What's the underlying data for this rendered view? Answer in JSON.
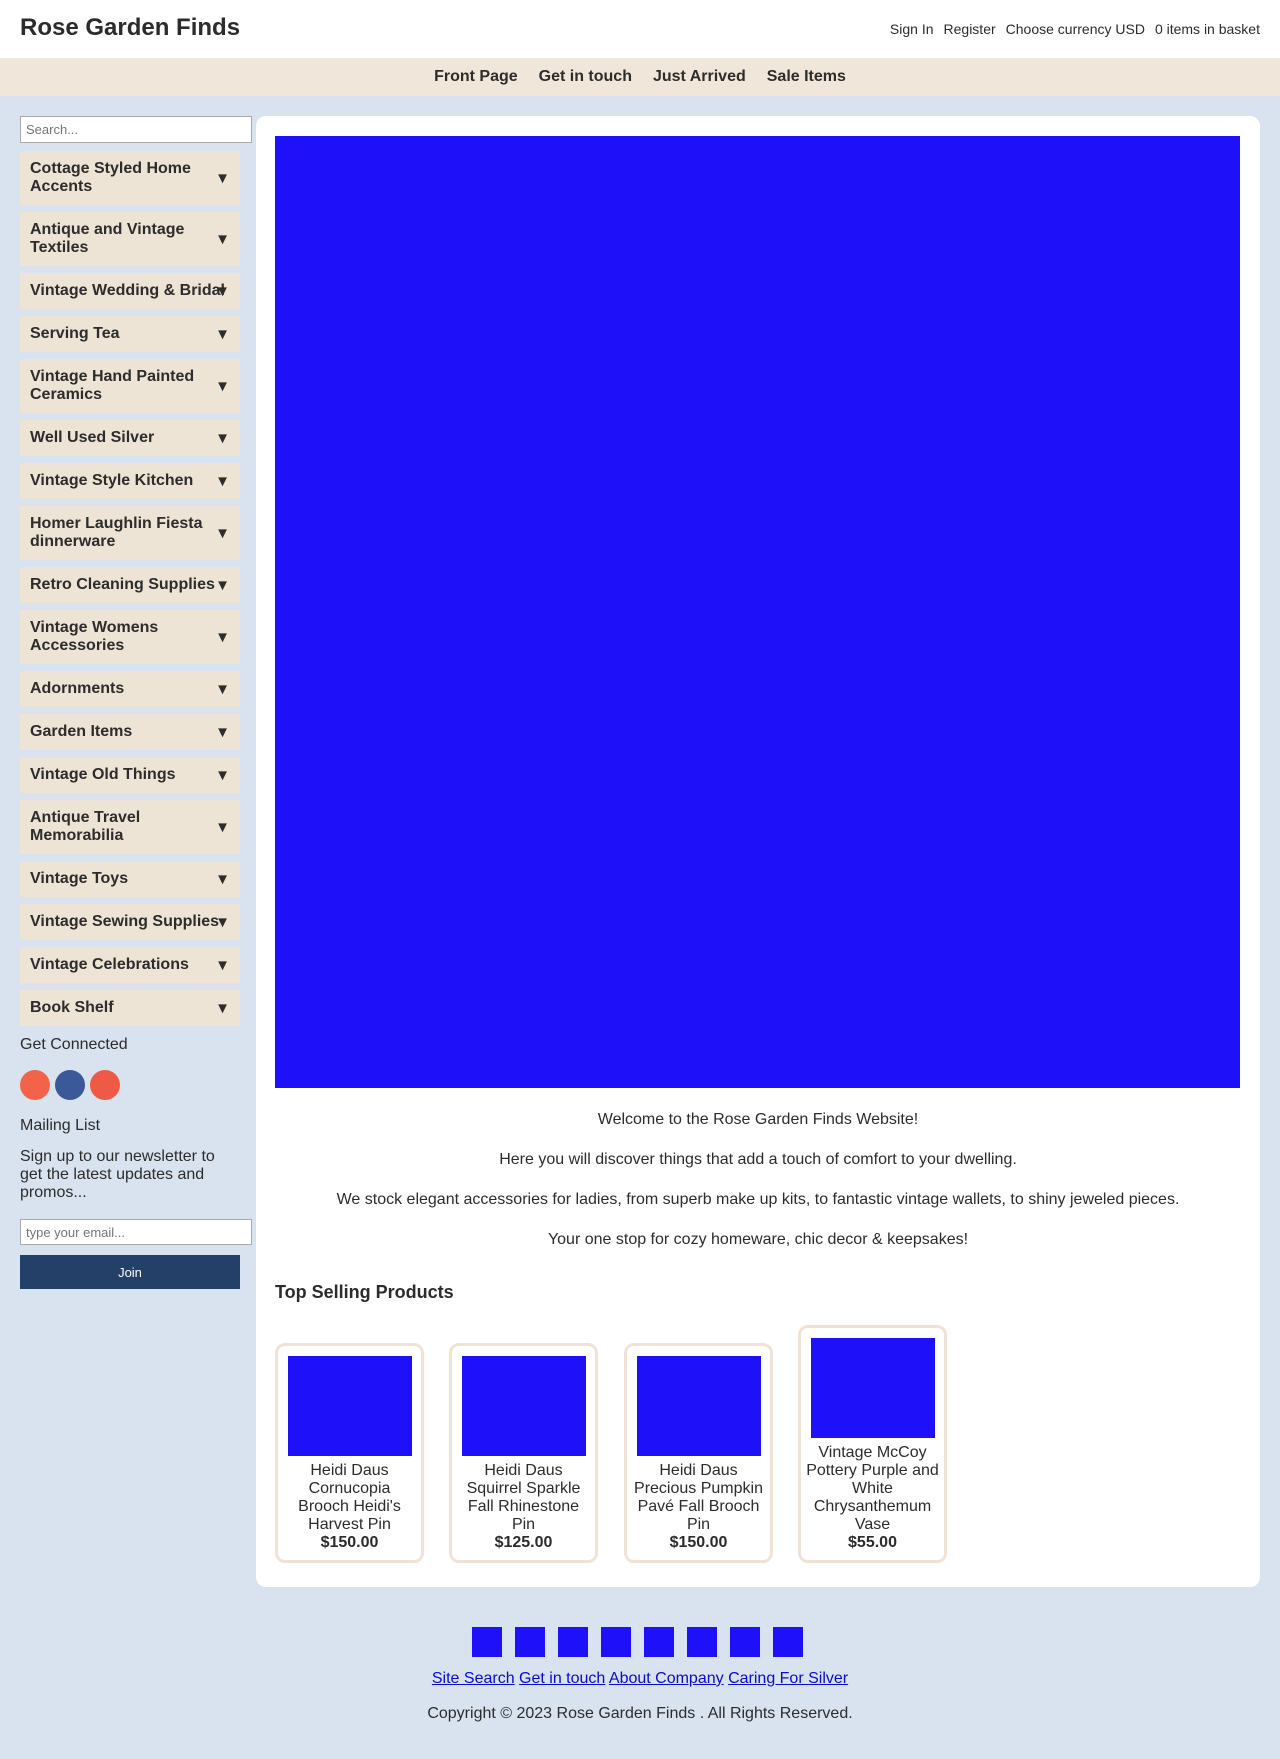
{
  "header": {
    "title": "Rose Garden Finds",
    "links": [
      "Sign In",
      "Register",
      "Choose currency USD",
      "0 items in basket"
    ]
  },
  "nav": [
    "Front Page",
    "Get in touch",
    "Just Arrived",
    "Sale Items"
  ],
  "sidebar": {
    "search_placeholder": "Search...",
    "categories": [
      "Cottage Styled Home Accents",
      "Antique and Vintage Textiles",
      "Vintage Wedding & Bridal",
      "Serving Tea",
      "Vintage Hand Painted Ceramics",
      "Well Used Silver",
      "Vintage Style Kitchen",
      "Homer Laughlin Fiesta dinnerware",
      "Retro Cleaning Supplies",
      "Vintage Womens Accessories",
      "Adornments",
      "Garden Items",
      "Vintage Old Things",
      "Antique Travel Memorabilia",
      "Vintage Toys",
      "Vintage Sewing Supplies",
      "Vintage Celebrations",
      "Book Shelf"
    ],
    "arrow": "▼",
    "get_connected": "Get Connected",
    "social_colors": [
      "#f2634a",
      "#3b5998",
      "#ee5a45"
    ],
    "mailing_title": "Mailing List",
    "mailing_text": "Sign up to our newsletter to get the latest updates and promos...",
    "email_placeholder": "type your email...",
    "join_label": "Join"
  },
  "main": {
    "welcome": [
      "Welcome to the Rose Garden Finds Website!",
      "Here you will discover things that add a touch of comfort to your dwelling.",
      "We stock elegant accessories for ladies, from superb make up kits, to fantastic vintage wallets, to shiny jeweled pieces.",
      "Your one stop for cozy homeware, chic decor & keepsakes!"
    ],
    "top_selling_title": "Top Selling Products",
    "products": [
      {
        "name": "Heidi Daus Cornucopia Brooch Heidi's Harvest Pin",
        "price": "$150.00"
      },
      {
        "name": "Heidi Daus Squirrel Sparkle Fall Rhinestone Pin",
        "price": "$125.00"
      },
      {
        "name": "Heidi Daus Precious Pumpkin Pavé Fall Brooch Pin",
        "price": "$150.00"
      },
      {
        "name": "Vintage McCoy Pottery Purple and White Chrysanthemum Vase",
        "price": "$55.00"
      }
    ]
  },
  "footer": {
    "links": [
      "Site Search",
      "Get in touch",
      "About Company",
      "Caring For Silver"
    ],
    "copyright": "Copyright © 2023 Rose Garden Finds . All Rights Reserved."
  },
  "colors": {
    "accent_beige": "#f0e6d9",
    "page_background": "#d9e2ef",
    "join_button": "#234068",
    "image_placeholder": "#1e10f8"
  }
}
